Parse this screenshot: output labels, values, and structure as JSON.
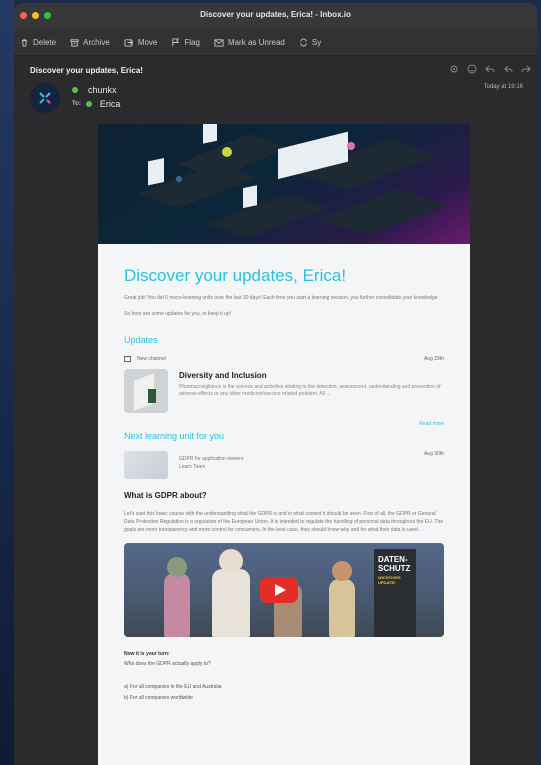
{
  "window": {
    "title": "Discover your updates, Erica! - Inbox.io"
  },
  "toolbar": [
    {
      "icon": "trash-icon",
      "label": "Delete"
    },
    {
      "icon": "archive-icon",
      "label": "Archive"
    },
    {
      "icon": "move-icon",
      "label": "Move"
    },
    {
      "icon": "flag-icon",
      "label": "Flag"
    },
    {
      "icon": "envelope-icon",
      "label": "Mark as Unread"
    },
    {
      "icon": "sync-icon",
      "label": "Sy"
    }
  ],
  "message": {
    "subject": "Discover your updates, Erica!",
    "from": "chunkx",
    "to_label": "To:",
    "to": "Erica",
    "time": "Today at 19:16",
    "header_icons": [
      "settings-icon",
      "emoji-icon",
      "reply-icon",
      "reply-all-icon",
      "forward-icon"
    ]
  },
  "email": {
    "heading": "Discover your updates, Erica!",
    "intro": "Great job! You did 6 micro-learning units over the last 30 days! Each time you start a learning session, you further consolidate your knowledge.",
    "intro2": "So here are some updates for you, to keep it up!",
    "updates_heading": "Updates",
    "new_channel_label": "New channel",
    "new_channel_date": "Aug 29th",
    "news_title": "Diversity and Inclusion",
    "news_desc": "Pharmacovigilance is the science and activities relating to the detection, assessment, understanding and prevention of adverse effects or any other medicine/vaccine related problem. All ...",
    "read_more": "Read more",
    "next_heading": "Next learning unit for you",
    "lu_title": "GDPR for application owners",
    "lu_sub": "Learn Team",
    "lu_date": "Aug 30th",
    "gdpr_heading": "What is GDPR about?",
    "gdpr_text": "Let's start this basic course with the understanding what the GDPR is and in what context it should be seen. First of all, the GDPR or General Data Protection Regulation is a regulation of the European Union. It is intended to regulate the handling of personal data throughout the EU. The goals are more transparency and more control for consumers. In the best case, they should know why and for what their data is used.",
    "video_sign_1": "DATEN-",
    "video_sign_2": "SCHUTZ",
    "video_sign_3": "WICHTIGES UPDATE!",
    "now_turn": "Now it is your turn:",
    "question": "Who does the GDPR actually apply to?",
    "answer_a": "a) For all companies in the EU and Australia",
    "answer_b": "b) For all companies worldwide"
  }
}
